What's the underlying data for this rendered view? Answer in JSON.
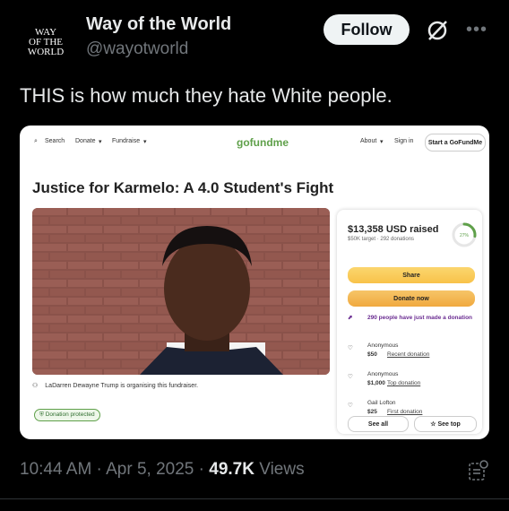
{
  "author": {
    "avatar_lines": [
      "WAY",
      "OF THE",
      "WORLD"
    ],
    "name": "Way of the World",
    "handle": "@wayotworld",
    "follow_label": "Follow"
  },
  "tweet": {
    "text": "THIS is how much they hate White people.",
    "time": "10:44 AM",
    "date": "Apr 5, 2025",
    "views_count": "49.7K",
    "views_label": "Views"
  },
  "card": {
    "nav": {
      "search": "Search",
      "donate": "Donate",
      "fundraise": "Fundraise",
      "logo": "gofundme",
      "about": "About",
      "signin": "Sign in",
      "start": "Start a GoFundMe"
    },
    "title": "Justice for Karmelo: A 4.0 Student's Fight",
    "organiser": "LaDarren Dewayne Trump is organising this fundraiser.",
    "protected": "Donation protected",
    "raised": "$13,358 USD raised",
    "target": "$50K target · 292 donations",
    "progress_label": "27%",
    "progress_fraction": 0.27,
    "share": "Share",
    "donate_now": "Donate now",
    "notice": "290 people have just made a donation",
    "donors": [
      {
        "name": "Anonymous",
        "amount": "$50",
        "type": "Recent donation"
      },
      {
        "name": "Anonymous",
        "amount": "$1,000",
        "type": "Top donation"
      },
      {
        "name": "Gail Lofton",
        "amount": "$25",
        "type": "First donation"
      }
    ],
    "see_all": "See all",
    "see_top": "See top"
  },
  "colors": {
    "background": "#000000",
    "follow_bg": "#eff3f4",
    "gofundme_green": "#5fa04a",
    "share_yellow": "#f8c24a",
    "muted_text": "#71767b"
  }
}
